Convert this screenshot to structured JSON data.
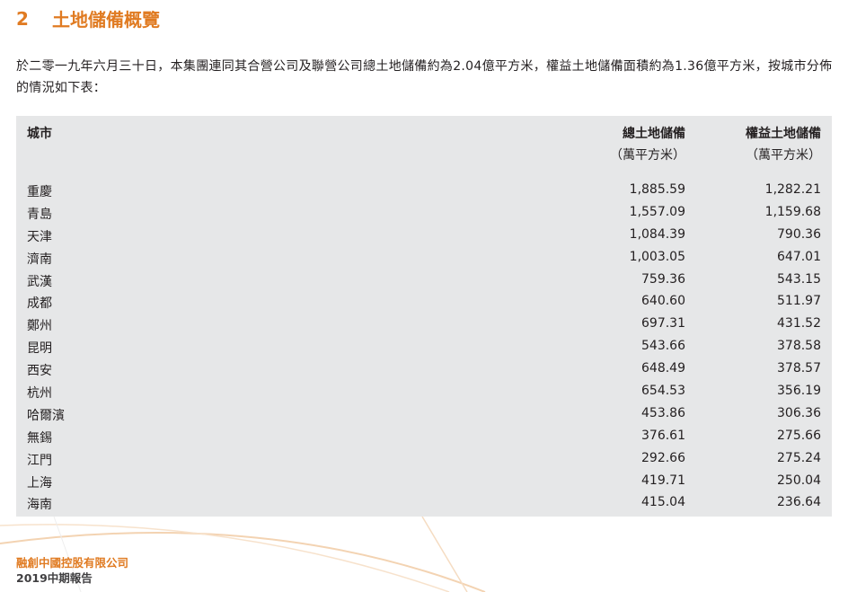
{
  "section": {
    "number": "2",
    "title": "土地儲備概覽"
  },
  "intro_text": "於二零一九年六月三十日，本集團連同其合營公司及聯營公司總土地儲備約為2.04億平方米，權益土地儲備面積約為1.36億平方米，按城市分佈的情況如下表：",
  "table": {
    "headers": {
      "city": "城市",
      "total": "總土地儲備",
      "total_unit": "（萬平方米）",
      "equity": "權益土地儲備",
      "equity_unit": "（萬平方米）"
    },
    "rows": [
      {
        "city": "重慶",
        "total": "1,885.59",
        "equity": "1,282.21"
      },
      {
        "city": "青島",
        "total": "1,557.09",
        "equity": "1,159.68"
      },
      {
        "city": "天津",
        "total": "1,084.39",
        "equity": "790.36"
      },
      {
        "city": "濟南",
        "total": "1,003.05",
        "equity": "647.01"
      },
      {
        "city": "武漢",
        "total": "759.36",
        "equity": "543.15"
      },
      {
        "city": "成都",
        "total": "640.60",
        "equity": "511.97"
      },
      {
        "city": "鄭州",
        "total": "697.31",
        "equity": "431.52"
      },
      {
        "city": "昆明",
        "total": "543.66",
        "equity": "378.58"
      },
      {
        "city": "西安",
        "total": "648.49",
        "equity": "378.57"
      },
      {
        "city": "杭州",
        "total": "654.53",
        "equity": "356.19"
      },
      {
        "city": "哈爾濱",
        "total": "453.86",
        "equity": "306.36"
      },
      {
        "city": "無錫",
        "total": "376.61",
        "equity": "275.66"
      },
      {
        "city": "江門",
        "total": "292.66",
        "equity": "275.24"
      },
      {
        "city": "上海",
        "total": "419.71",
        "equity": "250.04"
      },
      {
        "city": "海南",
        "total": "415.04",
        "equity": "236.64"
      }
    ]
  },
  "footer": {
    "company": "融創中國控股有限公司",
    "report": "2019中期報告"
  },
  "colors": {
    "accent": "#e07b22",
    "table_bg": "#e6e7e8"
  }
}
